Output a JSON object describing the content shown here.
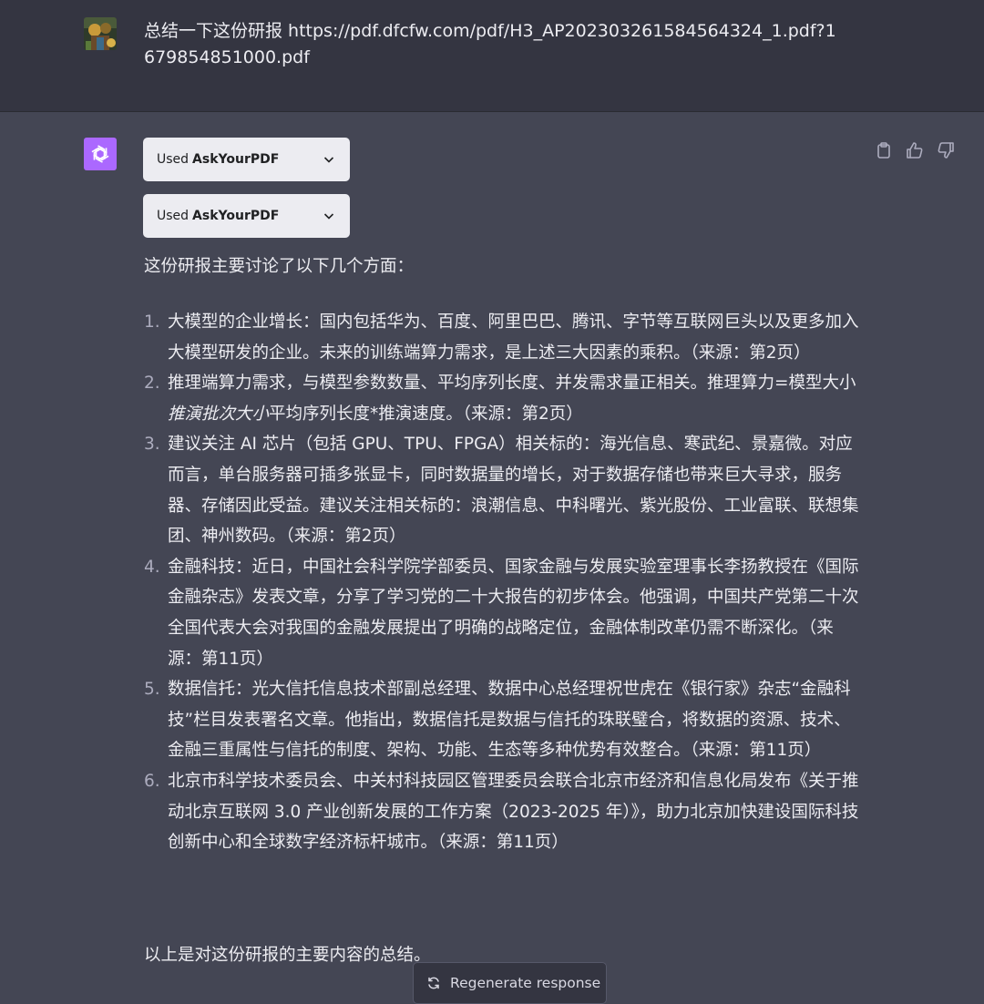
{
  "user_message": {
    "text": "总结一下这份研报 https://pdf.dfcfw.com/pdf/H3_AP202303261584564324_1.pdf?1679854851000.pdf"
  },
  "assistant": {
    "plugins": [
      {
        "used": "Used",
        "name": "AskYourPDF"
      },
      {
        "used": "Used",
        "name": "AskYourPDF"
      }
    ],
    "intro": "这份研报主要讨论了以下几个方面：",
    "items": [
      {
        "num": "1.",
        "pre": "大模型的企业增长：国内包括华为、百度、阿里巴巴、腾讯、字节等互联网巨头以及更多加入大模型研发的企业。未来的训练端算力需求，是上述三大因素的乘积。（来源：第2页）",
        "em": "",
        "post": ""
      },
      {
        "num": "2.",
        "pre": "推理端算力需求，与模型参数数量、平均序列长度、并发需求量正相关。推理算力=模型大小",
        "em": "推演批次大小",
        "post": "平均序列长度*推演速度。（来源：第2页）"
      },
      {
        "num": "3.",
        "pre": "建议关注 AI 芯片（包括 GPU、TPU、FPGA）相关标的：海光信息、寒武纪、景嘉微。对应而言，单台服务器可插多张显卡，同时数据量的增长，对于数据存储也带来巨大寻求，服务器、存储因此受益。建议关注相关标的：浪潮信息、中科曙光、紫光股份、工业富联、联想集团、神州数码。（来源：第2页）",
        "em": "",
        "post": ""
      },
      {
        "num": "4.",
        "pre": "金融科技：近日，中国社会科学院学部委员、国家金融与发展实验室理事长李扬教授在《国际金融杂志》发表文章，分享了学习党的二十大报告的初步体会。他强调，中国共产党第二十次全国代表大会对我国的金融发展提出了明确的战略定位，金融体制改革仍需不断深化。（来源：第11页）",
        "em": "",
        "post": ""
      },
      {
        "num": "5.",
        "pre": "数据信托：光大信托信息技术部副总经理、数据中心总经理祝世虎在《银行家》杂志“金融科技”栏目发表署名文章。他指出，数据信托是数据与信托的珠联璧合，将数据的资源、技术、金融三重属性与信托的制度、架构、功能、生态等多种优势有效整合。（来源：第11页）",
        "em": "",
        "post": ""
      },
      {
        "num": "6.",
        "pre": "北京市科学技术委员会、中关村科技园区管理委员会联合北京市经济和信息化局发布《关于推动北京互联网 3.0 产业创新发展的工作方案（2023-2025 年）》，助力北京加快建设国际科技创新中心和全球数字经济标杆城市。（来源：第11页）",
        "em": "",
        "post": ""
      }
    ],
    "outro": "以上是对这份研报的主要内容的总结。"
  },
  "regenerate_button": {
    "label": "Regenerate response"
  },
  "icons": {
    "copy": "clipboard-icon",
    "thumbs_up": "thumbs-up-icon",
    "thumbs_down": "thumbs-down-icon",
    "chevron": "chevron-down-icon",
    "regenerate": "refresh-icon"
  },
  "colors": {
    "user_bg": "#343541",
    "assistant_bg": "#444654",
    "gpt_avatar": "#ab68ff"
  }
}
